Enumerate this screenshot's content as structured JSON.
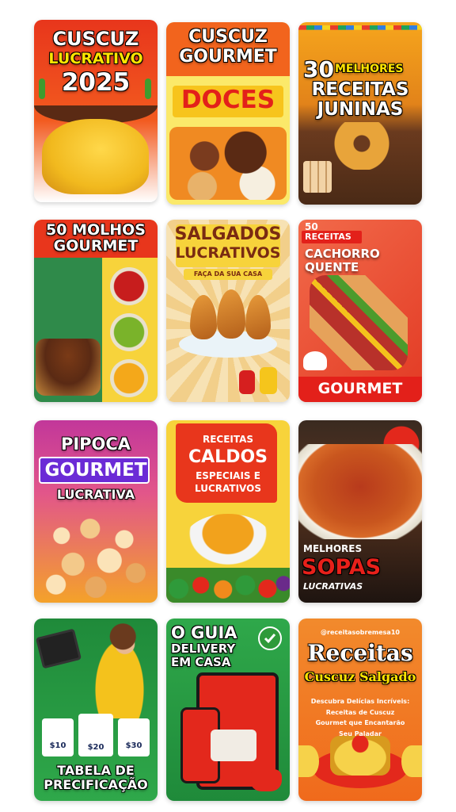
{
  "cards": [
    {
      "lines": [
        "CUSCUZ",
        "LUCRATIVO",
        "2025"
      ]
    },
    {
      "lines": [
        "CUSCUZ",
        "GOURMET",
        "DOCES"
      ]
    },
    {
      "number": "30",
      "lines": [
        "MELHORES",
        "RECEITAS",
        "JUNINAS"
      ]
    },
    {
      "lines": [
        "50 MOLHOS",
        "GOURMET"
      ]
    },
    {
      "lines": [
        "SALGADOS",
        "LUCRATIVOS",
        "FAÇA DA SUA CASA"
      ]
    },
    {
      "lines": [
        "50",
        "RECEITAS",
        "CACHORRO",
        "QUENTE",
        "GOURMET"
      ]
    },
    {
      "lines": [
        "PIPOCA",
        "GOURMET",
        "LUCRATIVA"
      ]
    },
    {
      "lines": [
        "RECEITAS",
        "CALDOS",
        "ESPECIAIS E",
        "LUCRATIVOS"
      ]
    },
    {
      "lines": [
        "MELHORES",
        "SOPAS",
        "LUCRATIVAS"
      ]
    },
    {
      "prices": [
        "$10",
        "$20",
        "$30"
      ],
      "lines": [
        "TABELA DE",
        "PRECIFICAÇÃO"
      ]
    },
    {
      "lines": [
        "O GUIA",
        "DELIVERY",
        "EM CASA"
      ]
    },
    {
      "handle": "@receitasobremesa10",
      "lines": [
        "Receitas",
        "Cuscuz Salgado"
      ],
      "description": "Descubra Delícias Incríveis: Receitas de Cuscuz Gourmet que Encantarão Seu Paladar"
    }
  ]
}
